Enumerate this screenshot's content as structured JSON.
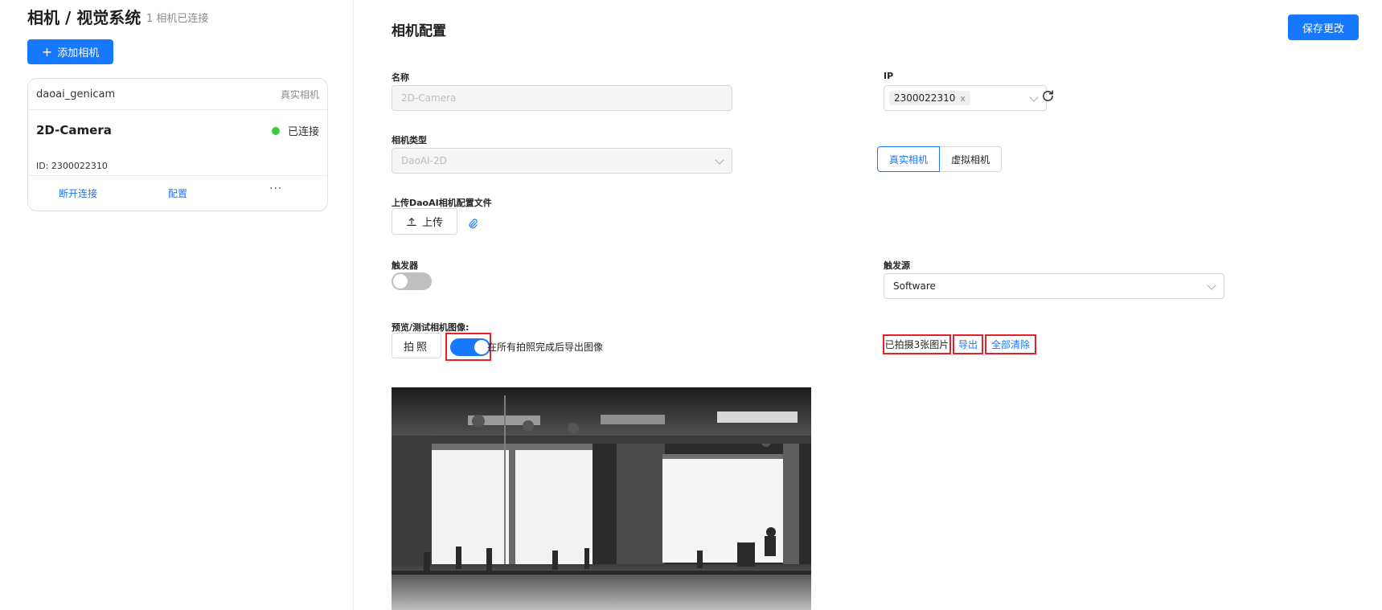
{
  "sidebar": {
    "title": "相机 / 视觉系统",
    "connected_count": "1 相机已连接",
    "add_button": "添加相机",
    "card": {
      "driver": "daoai_genicam",
      "kind": "真实相机",
      "name": "2D-Camera",
      "status": "已连接",
      "status_color": "#3ec93e",
      "id_label": "ID: 2300022310",
      "actions": {
        "disconnect": "断开连接",
        "configure": "配置",
        "more": "···"
      }
    }
  },
  "main": {
    "title": "相机配置",
    "save_button": "保存更改",
    "name": {
      "label": "名称",
      "value": "2D-Camera"
    },
    "ip": {
      "label": "IP",
      "tag": "2300022310",
      "remove": "x"
    },
    "camera_type": {
      "label": "相机类型",
      "value": "DaoAI-2D"
    },
    "camera_mode": {
      "options": [
        "真实相机",
        "虚拟相机"
      ],
      "selected": "真实相机"
    },
    "upload": {
      "label": "上传DaoAI相机配置文件",
      "button": "上传"
    },
    "trigger": {
      "label": "触发器",
      "enabled": false
    },
    "trigger_source": {
      "label": "触发源",
      "value": "Software"
    },
    "preview": {
      "label": "预览/测试相机图像:",
      "shoot_button": "拍照",
      "export_after_all": true,
      "export_hint": "在所有拍照完成后导出图像",
      "count_text": "已拍摄3张图片",
      "export_link": "导出",
      "clear_link": "全部清除"
    }
  },
  "colors": {
    "accent": "#1677ff",
    "highlight": "#e8202a"
  }
}
